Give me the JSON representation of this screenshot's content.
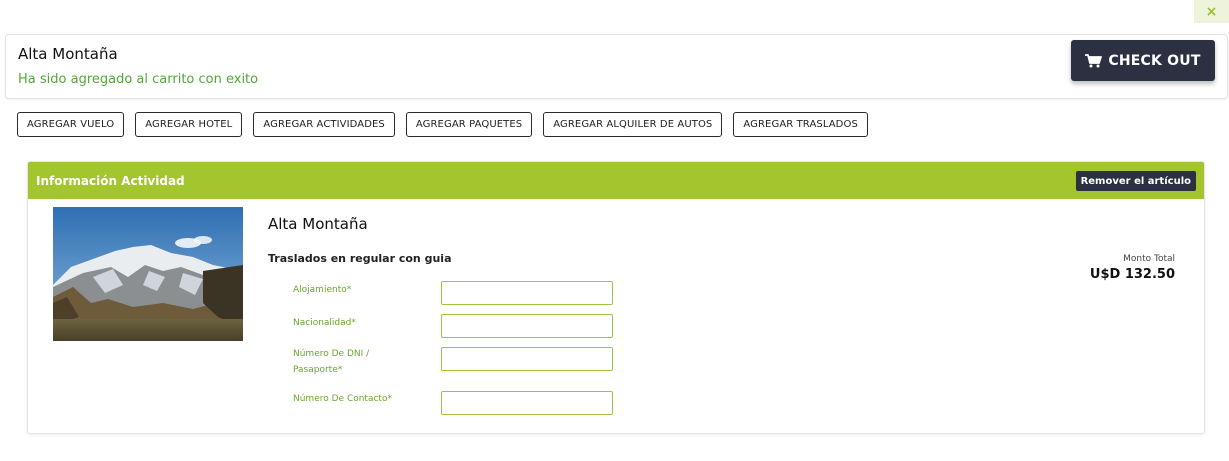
{
  "close_glyph": "×",
  "notification": {
    "title": "Alta Montaña",
    "message": "Ha sido agregado al carrito con exito",
    "message_color": "#52a838"
  },
  "checkout": {
    "label": "CHECK OUT",
    "icon": "cart-icon",
    "color": "#2b3140"
  },
  "add_buttons": [
    "AGREGAR VUELO",
    "AGREGAR HOTEL",
    "AGREGAR ACTIVIDADES",
    "AGREGAR PAQUETES",
    "AGREGAR ALQUILER DE AUTOS",
    "AGREGAR TRASLADOS"
  ],
  "activity_card": {
    "header": "Información Actividad",
    "header_color": "#a3c62e",
    "remove_label": "Remover el artículo",
    "image": "mountain-photo",
    "title": "Alta Montaña",
    "subtitle": "Traslados en regular con guia",
    "fields": [
      {
        "label": "Alojamiento*",
        "value": ""
      },
      {
        "label": "Nacionalidad*",
        "value": ""
      },
      {
        "label": "Número De DNI / Pasaporte*",
        "value": ""
      },
      {
        "label": "Número De Contacto*",
        "value": ""
      }
    ],
    "total_label": "Monto Total",
    "total_value": "U$D 132.50"
  }
}
